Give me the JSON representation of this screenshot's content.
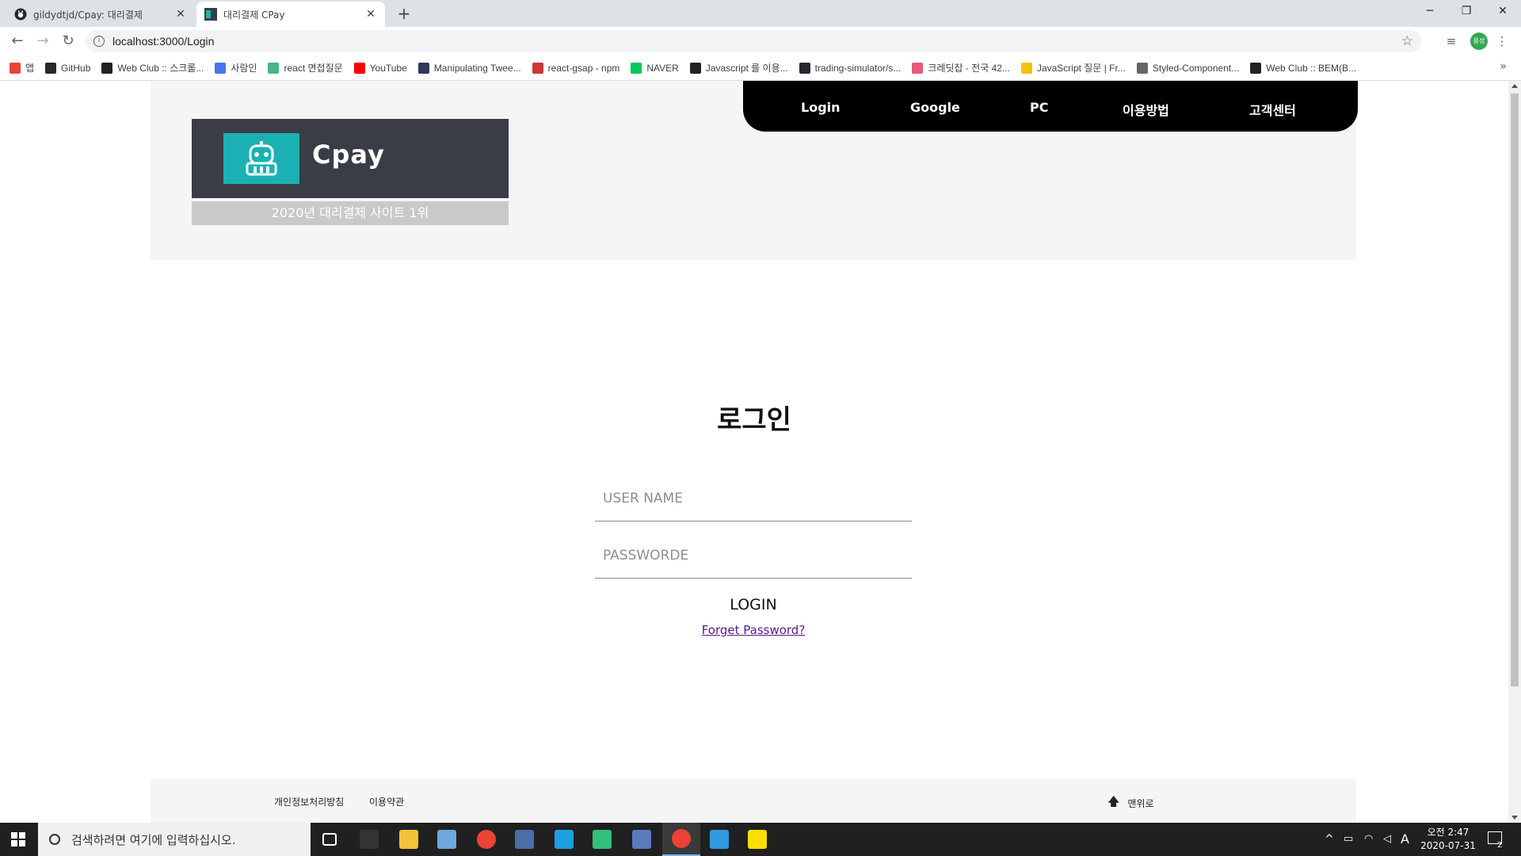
{
  "browser": {
    "tabs": [
      {
        "title": "gildydtjd/Cpay: 대리결제",
        "icon": "github-icon",
        "active": false
      },
      {
        "title": "대리결제 CPay",
        "icon": "cpay-favicon",
        "active": true
      }
    ],
    "new_tab": "+",
    "url": "localhost:3000/Login",
    "window_controls": {
      "minimize": "─",
      "restore": "❐",
      "close": "✕"
    },
    "profile_label": "용성",
    "bookmarks": [
      {
        "label": "앱",
        "icon": "apps-grid-icon",
        "color": "#ea4335"
      },
      {
        "label": "GitHub",
        "icon": "github-icon",
        "color": "#24292e"
      },
      {
        "label": "Web Club :: 스크롤...",
        "icon": "dots-icon",
        "color": "#222222"
      },
      {
        "label": "사람인",
        "icon": "saramin-icon",
        "color": "#4876ef"
      },
      {
        "label": "react 면접질문",
        "icon": "vue-icon",
        "color": "#41b883"
      },
      {
        "label": "YouTube",
        "icon": "youtube-icon",
        "color": "#ff0000"
      },
      {
        "label": "Manipulating Twee...",
        "icon": "hat-icon",
        "color": "#2e3a59"
      },
      {
        "label": "react-gsap - npm",
        "icon": "npm-icon",
        "color": "#cb3837"
      },
      {
        "label": "NAVER",
        "icon": "naver-icon",
        "color": "#03c75a"
      },
      {
        "label": "Javascript 를 이용...",
        "icon": "b-icon",
        "color": "#222222"
      },
      {
        "label": "trading-simulator/s...",
        "icon": "github-icon",
        "color": "#24292e"
      },
      {
        "label": "크레딧잡 - 전국 42...",
        "icon": "creditjob-icon",
        "color": "#e8587b"
      },
      {
        "label": "JavaScript 질문 | Fr...",
        "icon": "crown-icon",
        "color": "#f4c20d"
      },
      {
        "label": "Styled-Component...",
        "icon": "link-icon",
        "color": "#666666"
      },
      {
        "label": "Web Club :: BEM(B...",
        "icon": "dots-icon",
        "color": "#222222"
      }
    ],
    "bookmarks_more": "»"
  },
  "page": {
    "logo_text": "Cpay",
    "logo_subtitle": "2020년 대리결제 사이트 1위",
    "nav": [
      "Login",
      "Google",
      "PC",
      "이용방법",
      "고객센터"
    ],
    "login_title": "로그인",
    "username_placeholder": "USER NAME",
    "password_placeholder": "PASSWORDE",
    "login_button": "LOGIN",
    "forget_link": "Forget Password?",
    "footer": {
      "privacy": "개인정보처리방침",
      "terms": "이용약관",
      "to_top": "맨위로"
    }
  },
  "taskbar": {
    "search_placeholder": "검색하려면 여기에 입력하십시오.",
    "apps": [
      {
        "name": "task-view-icon",
        "color": "#ffffff"
      },
      {
        "name": "terminal-icon",
        "color": "#333333"
      },
      {
        "name": "file-explorer-icon",
        "color": "#f3c13a"
      },
      {
        "name": "notes-icon",
        "color": "#6fa8dc"
      },
      {
        "name": "chrome-icon",
        "color": "#ea4335"
      },
      {
        "name": "phpmyadmin-icon",
        "color": "#4b6ea8"
      },
      {
        "name": "ie-icon",
        "color": "#1ba1e2"
      },
      {
        "name": "edge-icon",
        "color": "#30c27c"
      },
      {
        "name": "sts-icon",
        "color": "#5a7bbd"
      },
      {
        "name": "chrome-active-icon",
        "color": "#ea4335"
      },
      {
        "name": "vscode-icon",
        "color": "#2f9ae0"
      },
      {
        "name": "kakaotalk-icon",
        "color": "#f9e000"
      }
    ],
    "tray_ime": "A",
    "clock_time": "오전 2:47",
    "clock_date": "2020-07-31",
    "notifications": "2"
  }
}
